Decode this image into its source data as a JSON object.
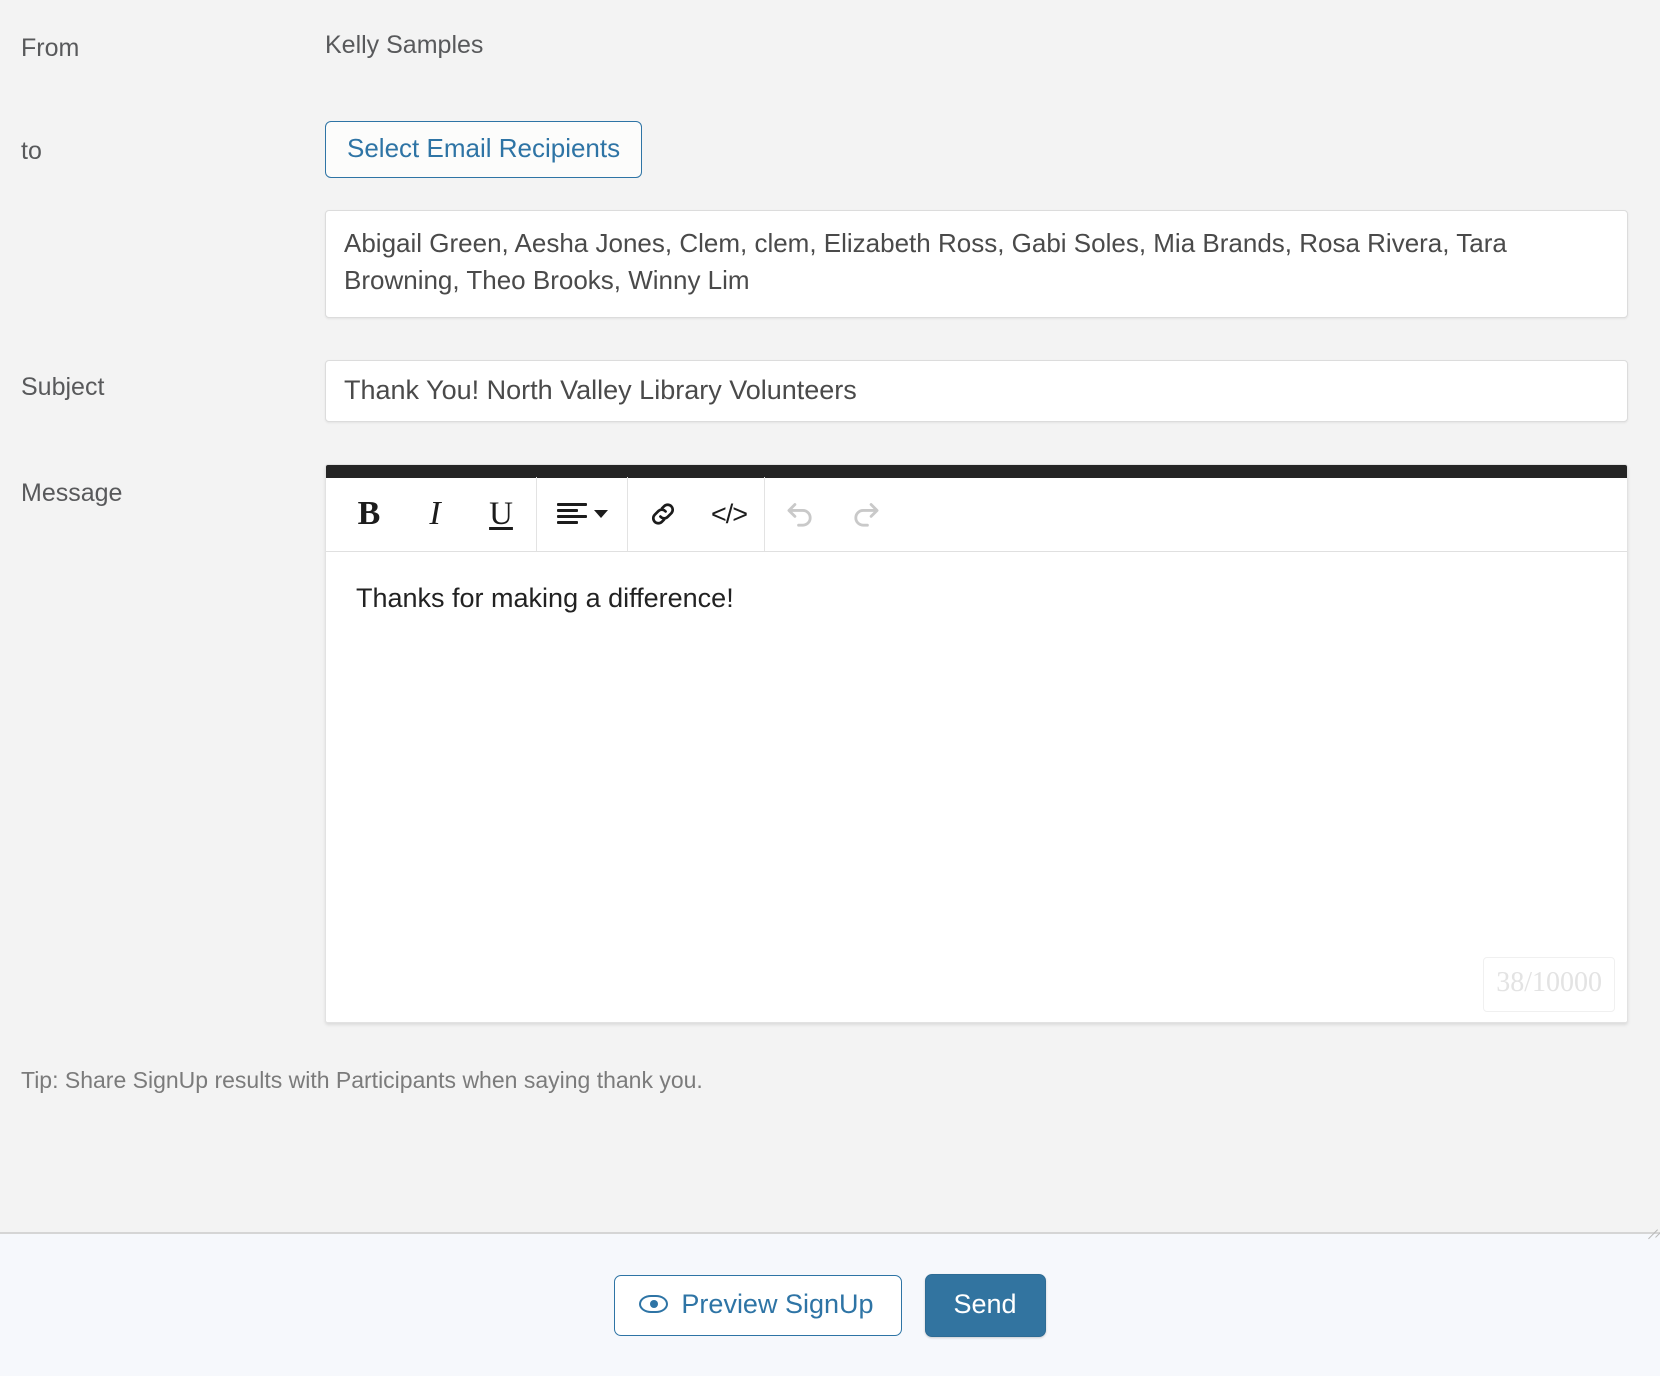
{
  "form": {
    "from": {
      "label": "From",
      "value": "Kelly Samples"
    },
    "to": {
      "label": "to",
      "select_recipients_button": "Select Email Recipients",
      "recipients_value": "Abigail Green, Aesha Jones, Clem, clem, Elizabeth Ross, Gabi Soles, Mia Brands, Rosa Rivera, Tara Browning, Theo Brooks, Winny Lim"
    },
    "subject": {
      "label": "Subject",
      "value": "Thank You! North Valley Library Volunteers"
    },
    "message": {
      "label": "Message",
      "body": "Thanks for making a difference!",
      "char_counter": "38/10000",
      "toolbar": {
        "bold": "B",
        "italic": "I",
        "underline": "U",
        "align": "align-left",
        "link": "link",
        "code": "</>",
        "undo": "undo",
        "redo": "redo"
      }
    }
  },
  "tip": "Tip: Share SignUp results with Participants when saying thank you.",
  "footer": {
    "preview_button": "Preview SignUp",
    "send_button": "Send"
  },
  "colors": {
    "accent": "#2e74a5",
    "send_button_bg": "#3274a0",
    "page_bg": "#f3f3f3",
    "footer_bg": "#f6f8fc",
    "editor_topbar": "#252525"
  }
}
